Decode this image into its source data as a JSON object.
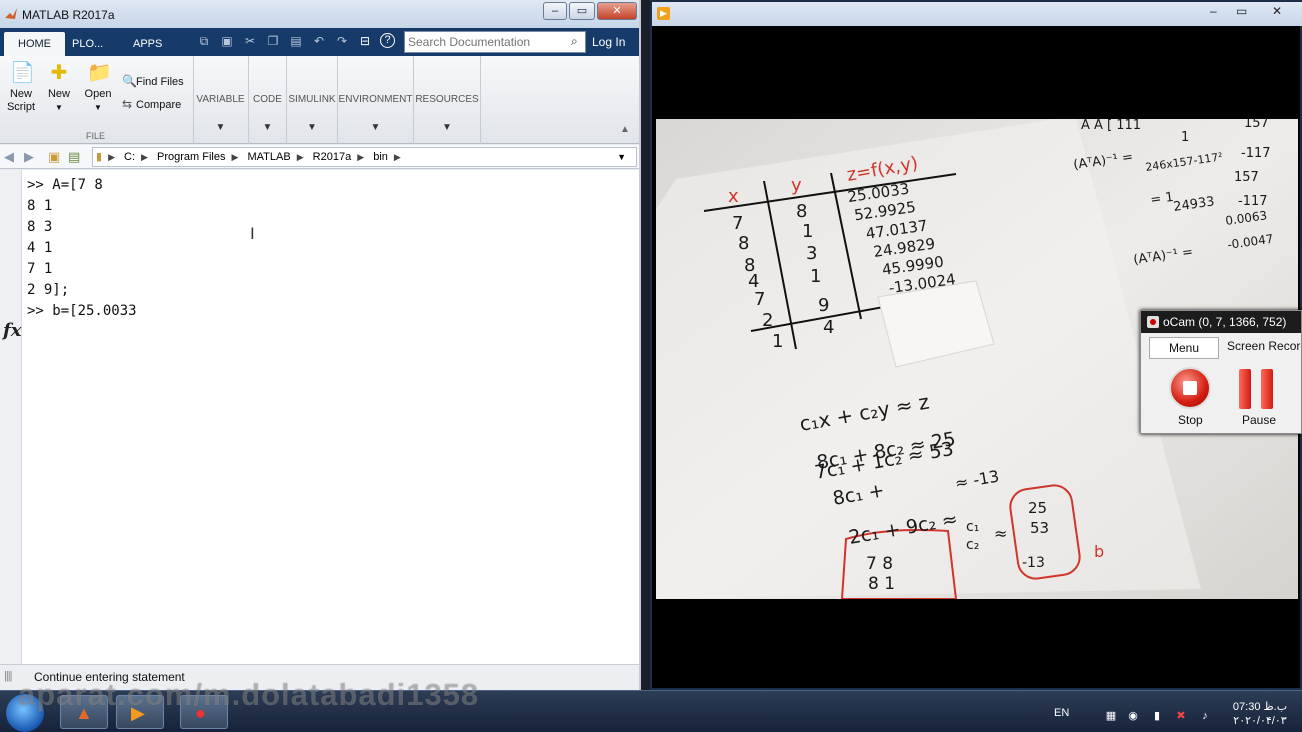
{
  "matlab": {
    "title": "MATLAB R2017a",
    "tabs": [
      "HOME",
      "PLO...",
      "APPS"
    ],
    "search_placeholder": "Search Documentation",
    "login": "Log In",
    "ribbon": {
      "new_script": "New\nScript",
      "new": "New",
      "open": "Open",
      "find_files": "Find Files",
      "compare": "Compare",
      "file_group": "FILE",
      "groups": [
        "VARIABLE",
        "CODE",
        "SIMULINK",
        "ENVIRONMENT",
        "RESOURCES"
      ]
    },
    "path": [
      "C:",
      "Program Files",
      "MATLAB",
      "R2017a",
      "bin"
    ],
    "command_lines": [
      ">> A=[7 8",
      "8 1",
      "8 3",
      "4 1",
      "7 1",
      "2 9];",
      ">> b=[25.0033"
    ],
    "fx": "fx",
    "status": "Continue entering statement"
  },
  "paper": {
    "headers": [
      "x",
      "y",
      "z=f(x,y)"
    ],
    "x_col": [
      "7",
      "8",
      "8",
      "4",
      "7",
      "2",
      "1"
    ],
    "y_col": [
      "8",
      "1",
      "3",
      "1",
      "9",
      "4"
    ],
    "z_col": [
      "25.0033",
      "52.9925",
      "47.0137",
      "24.9829",
      "45.9990",
      "-13.0024"
    ],
    "top_right": [
      "A  A  [ 111",
      "(AᵀA)⁻¹ =",
      "1",
      "246x157-117²",
      "= 1",
      "24933",
      "157",
      "-117",
      "-117",
      "0.0063",
      "-0.0047",
      "(AᵀA)⁻¹ ="
    ],
    "eqs": [
      "c₁x + c₂y ≈ z",
      "8c₁ + 8c₂ ≈ 25",
      "7c₁ + 1c₂ ≈ 53",
      "8c₁ + ",
      "≈ -13",
      "2c₁ + 9c₂ ≈",
      "c₁",
      "c₂",
      "≈",
      "25",
      "53",
      "-13",
      "b",
      "7   8",
      "8   1"
    ]
  },
  "ocam": {
    "title": "oCam (0, 7, 1366, 752)",
    "menu": "Menu",
    "screen_recording": "Screen Recordi",
    "stop": "Stop",
    "pause": "Pause"
  },
  "taskbar": {
    "watermark": "aparat.com/m.dolatabadi1358",
    "lang": "EN",
    "clock_time": "07:30 ب.ظ",
    "clock_date": "۲۰۲۰/۰۴/۰۳"
  },
  "colors": {
    "ribbon_tab_bg": "#163a6a",
    "taskbar": "#17233a",
    "red_ink": "#d0352c"
  }
}
